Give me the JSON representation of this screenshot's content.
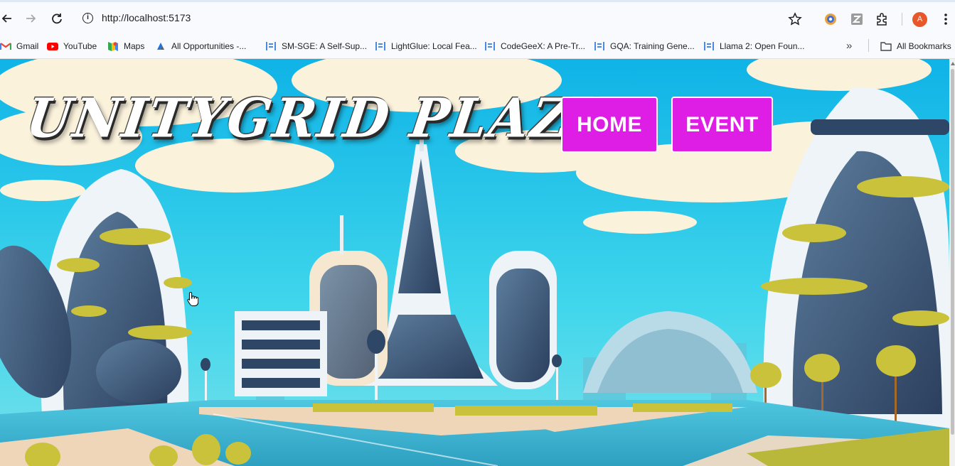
{
  "browser": {
    "url": "http://localhost:5173",
    "avatar_letter": "A",
    "bookmarks": [
      {
        "label": "Gmail",
        "icon": "gmail-icon"
      },
      {
        "label": "YouTube",
        "icon": "youtube-icon"
      },
      {
        "label": "Maps",
        "icon": "maps-icon"
      },
      {
        "label": "All Opportunities -...",
        "icon": "opportunities-icon"
      },
      {
        "label": "SM-SGE: A Self-Sup...",
        "icon": "doc-icon"
      },
      {
        "label": "LightGlue: Local Fea...",
        "icon": "doc-icon"
      },
      {
        "label": "CodeGeeX: A Pre-Tr...",
        "icon": "doc-icon"
      },
      {
        "label": "GQA: Training Gene...",
        "icon": "doc-icon"
      },
      {
        "label": "Llama 2: Open Foun...",
        "icon": "doc-icon"
      }
    ],
    "more_symbol": "»",
    "all_bookmarks": "All Bookmarks"
  },
  "page": {
    "title": "UNITYGRID PLAZA",
    "nav": {
      "home": "HOME",
      "event": "EVENT"
    },
    "nav_color": "#de1ee4"
  }
}
